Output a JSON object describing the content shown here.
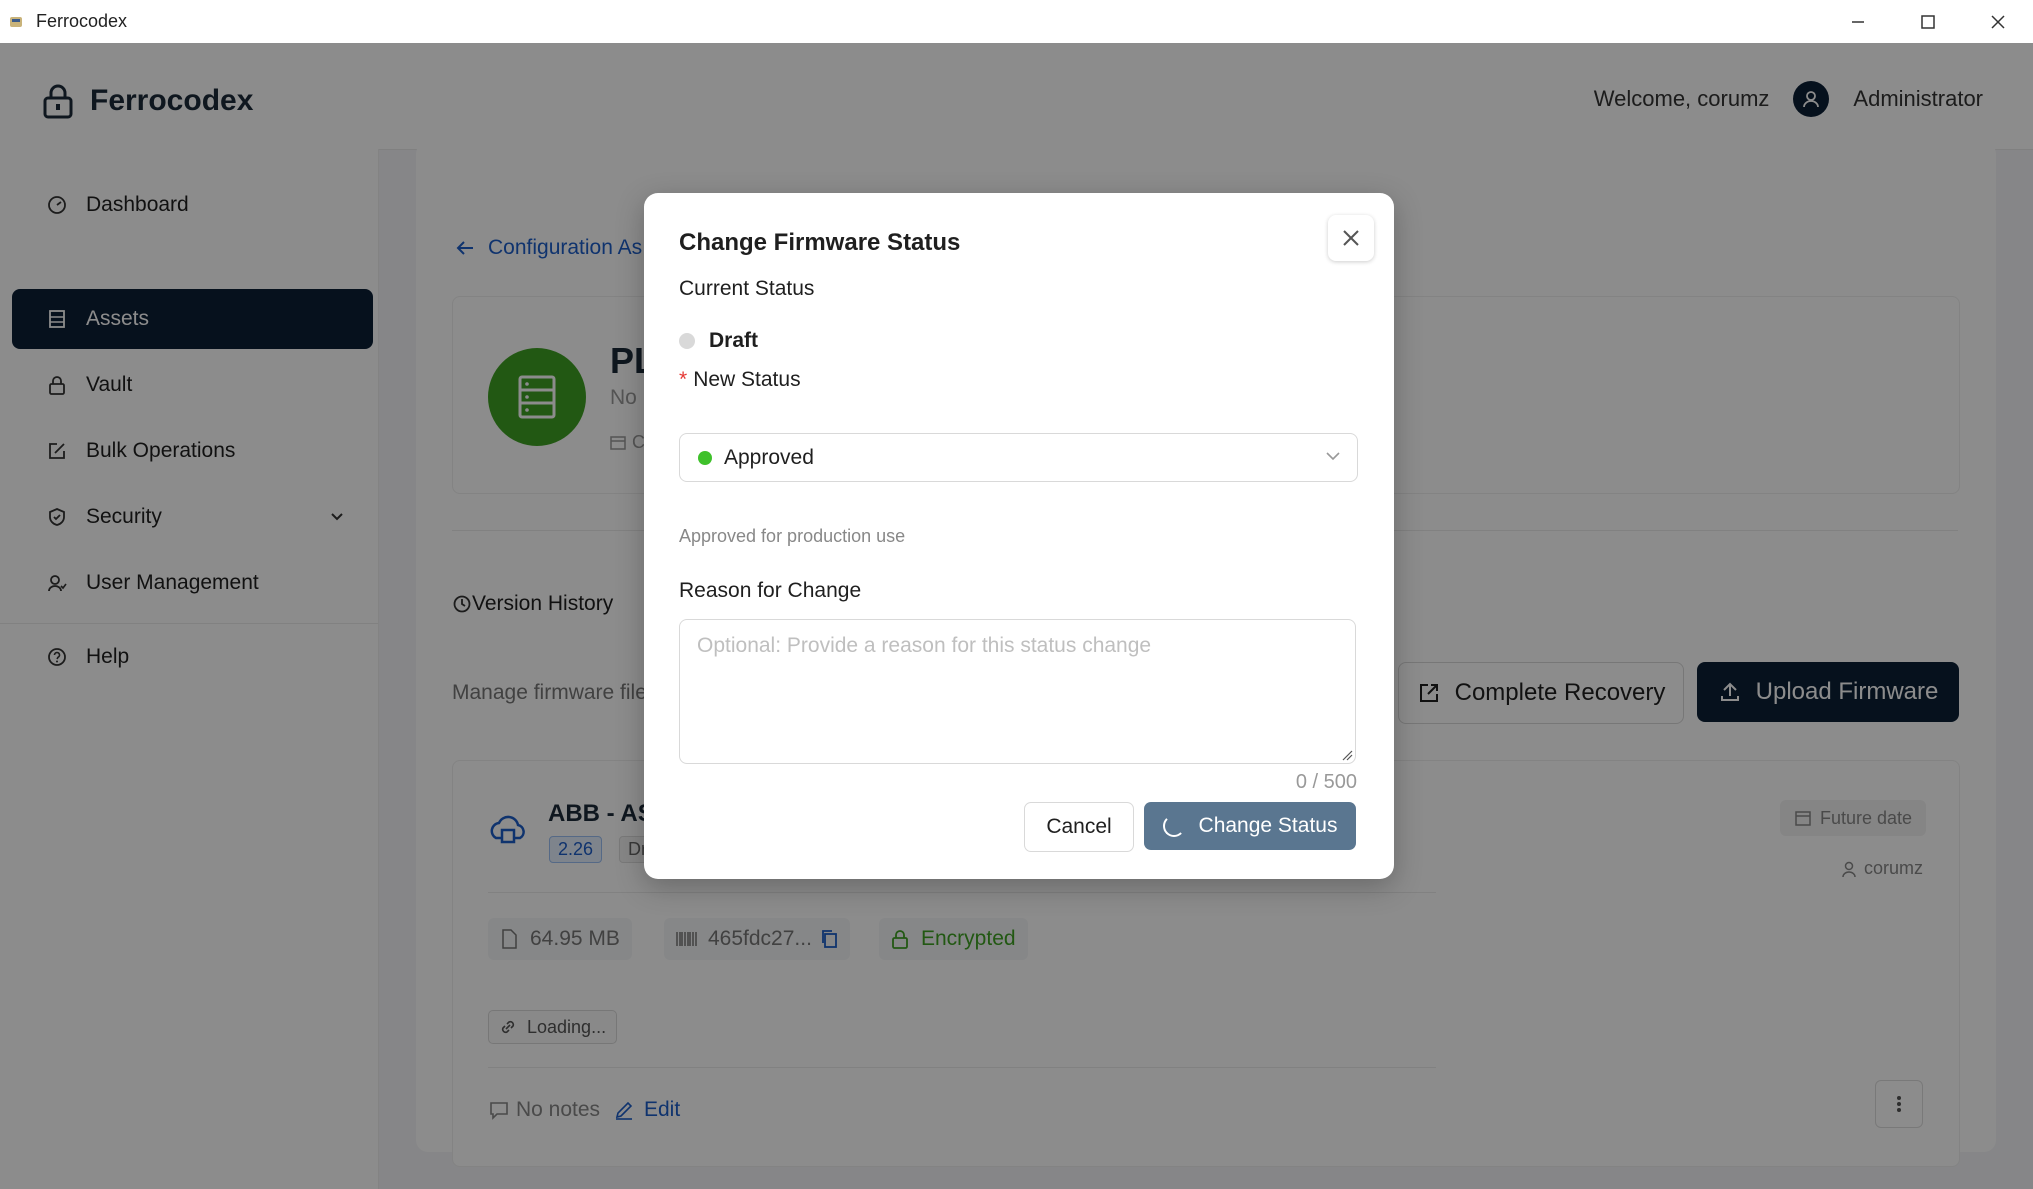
{
  "window": {
    "title": "Ferrocodex"
  },
  "header": {
    "brand": "Ferrocodex",
    "welcome": "Welcome, corumz",
    "role": "Administrator"
  },
  "sidebar": {
    "items": [
      {
        "label": "Dashboard",
        "icon": "dashboard-icon"
      },
      {
        "label": "Assets",
        "icon": "assets-icon",
        "active": true
      },
      {
        "label": "Vault",
        "icon": "lock-icon"
      },
      {
        "label": "Bulk Operations",
        "icon": "bulk-edit-icon"
      },
      {
        "label": "Security",
        "icon": "shield-icon"
      },
      {
        "label": "User Management",
        "icon": "users-icon"
      },
      {
        "label": "Help",
        "icon": "help-icon"
      }
    ]
  },
  "background": {
    "back_link": "Configuration As",
    "asset_name": "PL",
    "asset_sub": "No",
    "asset_date": "C",
    "tab_label": "Version History",
    "manage_text": "Manage firmware file",
    "complete_recovery": "Complete Recovery",
    "upload_firmware": "Upload Firmware",
    "firmware": {
      "name": "ABB - AS",
      "version": "2.26",
      "status": "Dr",
      "future_date": "Future date",
      "user": "corumz",
      "size": "64.95 MB",
      "hash": "465fdc27...",
      "encrypted": "Encrypted",
      "loading": "Loading...",
      "notes": "No notes",
      "edit": "Edit"
    }
  },
  "modal": {
    "title": "Change Firmware Status",
    "current_status_label": "Current Status",
    "current_status": "Draft",
    "new_status_required": "*",
    "new_status_label": "New Status",
    "new_status_value": "Approved",
    "status_help": "Approved for production use",
    "reason_label": "Reason for Change",
    "reason_placeholder": "Optional: Provide a reason for this status change",
    "char_count": "0 / 500",
    "cancel": "Cancel",
    "change_status": "Change Status"
  },
  "colors": {
    "primary": "#0b1f36",
    "link": "#1d5ec9",
    "success": "#3fa124",
    "approved_dot": "#3fc12b",
    "required": "#e53935"
  }
}
